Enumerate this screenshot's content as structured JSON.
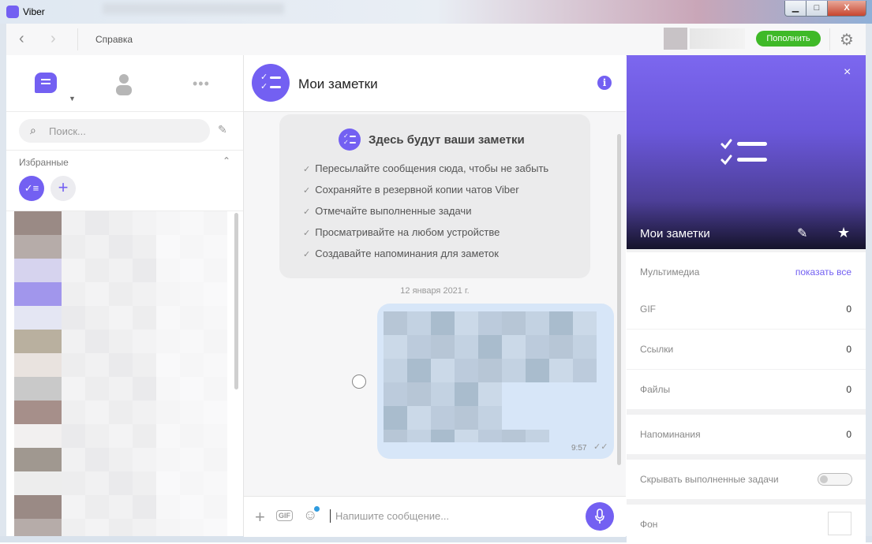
{
  "window": {
    "title": "Viber"
  },
  "titlebar_controls": {
    "minimize": "▁",
    "maximize": "□",
    "close": "X"
  },
  "topnav": {
    "back_icon": "‹",
    "forward_icon": "›",
    "title": "Справка",
    "topup_label": "Пополнить",
    "settings_icon": "⚙"
  },
  "sidebar": {
    "search_placeholder": "Поиск...",
    "search_icon": "⌕",
    "compose_icon": "✎",
    "favorites_label": "Избранные",
    "favorites_collapse_icon": "⌃",
    "fav_notes_icon": "✓≡",
    "fav_add_icon": "+",
    "tab_caret": "▼",
    "more_icon": "•••"
  },
  "chat": {
    "title": "Мои заметки",
    "info_icon": "i",
    "onboarding": {
      "title": "Здесь будут ваши заметки",
      "items": [
        "Пересылайте сообщения сюда, чтобы не забыть",
        "Сохраняйте в резервной копии чатов Viber",
        "Отмечайте выполненные задачи",
        "Просматривайте на любом устройстве",
        "Создавайте напоминания для заметок"
      ]
    },
    "date_separator": "12 января 2021 г.",
    "message": {
      "time": "9:57",
      "status_icon": "✓✓"
    },
    "composer": {
      "placeholder": "Напишите сообщение...",
      "attach_icon": "+",
      "gif_label": "GIF",
      "sticker_icon": "☺",
      "mic_icon": "🎤"
    }
  },
  "info_panel": {
    "close_icon": "×",
    "name": "Мои заметки",
    "edit_icon": "✎",
    "star_icon": "★",
    "media_label": "Мультимедиа",
    "media_link": "показать все",
    "rows": [
      {
        "label": "GIF",
        "value": "0"
      },
      {
        "label": "Ссылки",
        "value": "0"
      },
      {
        "label": "Файлы",
        "value": "0"
      },
      {
        "label": "Напоминания",
        "value": "0"
      }
    ],
    "hide_done_label": "Скрывать выполненные задачи",
    "hide_done_enabled": false,
    "background_label": "Фон"
  }
}
